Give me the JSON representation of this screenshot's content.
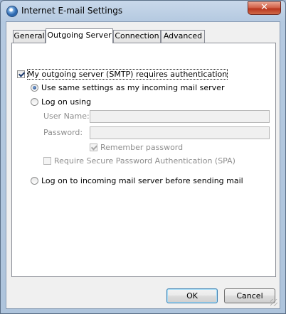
{
  "window": {
    "title": "Internet E-mail Settings",
    "close_symbol": "✕"
  },
  "tabs": [
    {
      "label": "General"
    },
    {
      "label": "Outgoing Server"
    },
    {
      "label": "Connection"
    },
    {
      "label": "Advanced"
    }
  ],
  "outgoing": {
    "smtp_auth": {
      "label": "My outgoing server (SMTP) requires authentication",
      "checked": true
    },
    "use_same": {
      "label": "Use same settings as my incoming mail server",
      "selected": true
    },
    "log_on_using": {
      "label": "Log on using",
      "selected": false
    },
    "user_name": {
      "label": "User Name:",
      "value": ""
    },
    "password": {
      "label": "Password:",
      "value": ""
    },
    "remember_password": {
      "label": "Remember password",
      "checked": true,
      "enabled": false
    },
    "spa": {
      "label": "Require Secure Password Authentication (SPA)",
      "checked": false,
      "enabled": false
    },
    "log_on_incoming_first": {
      "label": "Log on to incoming mail server before sending mail",
      "selected": false
    }
  },
  "buttons": {
    "ok": "OK",
    "cancel": "Cancel"
  }
}
